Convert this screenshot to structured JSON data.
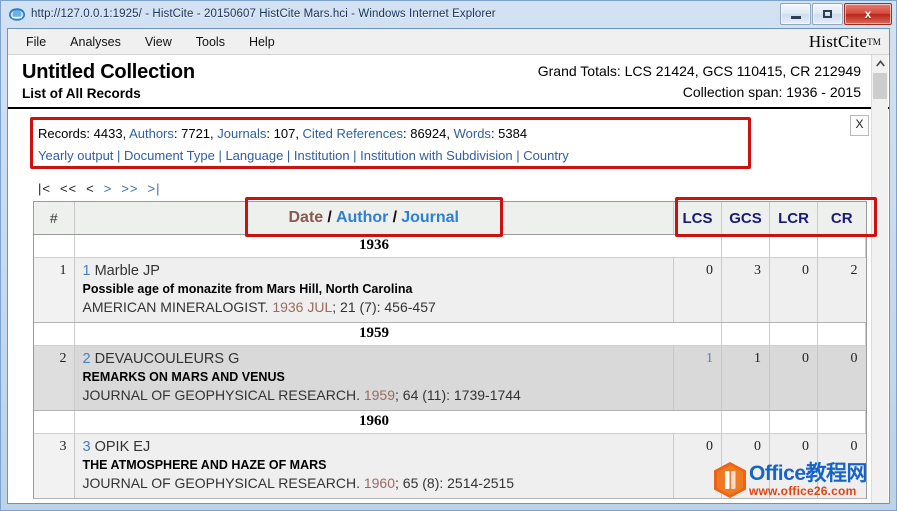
{
  "window": {
    "title": "http://127.0.0.1:1925/ - HistCite - 20150607 HistCite Mars.hci - Windows Internet Explorer",
    "minimize_label": "",
    "maximize_label": "",
    "close_label": "x"
  },
  "menubar": {
    "items": [
      {
        "label": "File"
      },
      {
        "label": "Analyses"
      },
      {
        "label": "View"
      },
      {
        "label": "Tools"
      },
      {
        "label": "Help"
      }
    ],
    "brand": "HistCite",
    "brand_tm": "TM"
  },
  "header": {
    "collection_title": "Untitled Collection",
    "collection_subtitle": "List of All Records",
    "grand_totals": "Grand Totals: LCS 21424, GCS 110415, CR 212949",
    "collection_span": "Collection span: 1936 - 2015"
  },
  "stats": {
    "close_label": "X",
    "line1": [
      {
        "text": "Records: ",
        "type": "label"
      },
      {
        "text": "4433",
        "type": "value"
      },
      {
        "text": ", ",
        "type": "plain"
      },
      {
        "text": "Authors",
        "type": "link"
      },
      {
        "text": ": 7721, ",
        "type": "plain"
      },
      {
        "text": "Journals",
        "type": "link"
      },
      {
        "text": ": 107, ",
        "type": "plain"
      },
      {
        "text": "Cited References",
        "type": "link"
      },
      {
        "text": ": 86924, ",
        "type": "plain"
      },
      {
        "text": "Words",
        "type": "link"
      },
      {
        "text": ": 5384",
        "type": "plain"
      }
    ],
    "line1_text": "Records: 4433, Authors: 7721, Journals: 107, Cited References: 86924, Words: 5384",
    "line2_links": [
      "Yearly output",
      "Document Type",
      "Language",
      "Institution",
      "Institution with Subdivision",
      "Country"
    ],
    "line2_separator": "|"
  },
  "pager": {
    "buttons": [
      {
        "label": "|<",
        "enabled": false
      },
      {
        "label": "<<",
        "enabled": false
      },
      {
        "label": "<",
        "enabled": false
      },
      {
        "label": ">",
        "enabled": true
      },
      {
        "label": ">>",
        "enabled": true
      },
      {
        "label": ">|",
        "enabled": true
      }
    ]
  },
  "table": {
    "headers": {
      "num": "#",
      "sort_date": "Date",
      "sort_author": "Author",
      "sort_journal": "Journal",
      "slash": "/",
      "lcs": "LCS",
      "gcs": "GCS",
      "lcr": "LCR",
      "cr": "CR"
    },
    "rows": [
      {
        "kind": "year",
        "year": "1936"
      },
      {
        "kind": "record",
        "num": "1",
        "index": "1",
        "author": "Marble JP",
        "title": "Possible age of monazite from Mars Hill, North Carolina",
        "source_pre": "AMERICAN MINERALOGIST. ",
        "source_year": "1936 JUL",
        "source_post": "; 21 (7): 456-457",
        "lcs": "0",
        "gcs": "3",
        "lcr": "0",
        "cr": "2",
        "lcs_is_link": false
      },
      {
        "kind": "year",
        "year": "1959"
      },
      {
        "kind": "record",
        "num": "2",
        "index": "2",
        "author": "DEVAUCOULEURS G",
        "title": "REMARKS ON MARS AND VENUS",
        "source_pre": "JOURNAL OF GEOPHYSICAL RESEARCH. ",
        "source_year": "1959",
        "source_post": "; 64 (11): 1739-1744",
        "lcs": "1",
        "gcs": "1",
        "lcr": "0",
        "cr": "0",
        "lcs_is_link": true
      },
      {
        "kind": "year",
        "year": "1960"
      },
      {
        "kind": "record",
        "num": "3",
        "index": "3",
        "author": "OPIK EJ",
        "title": "THE ATMOSPHERE AND HAZE OF MARS",
        "source_pre": "JOURNAL OF GEOPHYSICAL RESEARCH. ",
        "source_year": "1960",
        "source_post": "; 65 (8): 2514-2515",
        "lcs": "0",
        "gcs": "0",
        "lcr": "0",
        "cr": "0",
        "lcs_is_link": false
      }
    ]
  },
  "watermark": {
    "line1": "Office教程网",
    "line2": "www.office26.com"
  },
  "colors": {
    "annotation_red": "#cc1111",
    "link_blue": "#2f5f9e",
    "sort_active": "#8a5a4a",
    "header_navy": "#1a1a7a",
    "year_maroon": "#9b6a5e"
  }
}
